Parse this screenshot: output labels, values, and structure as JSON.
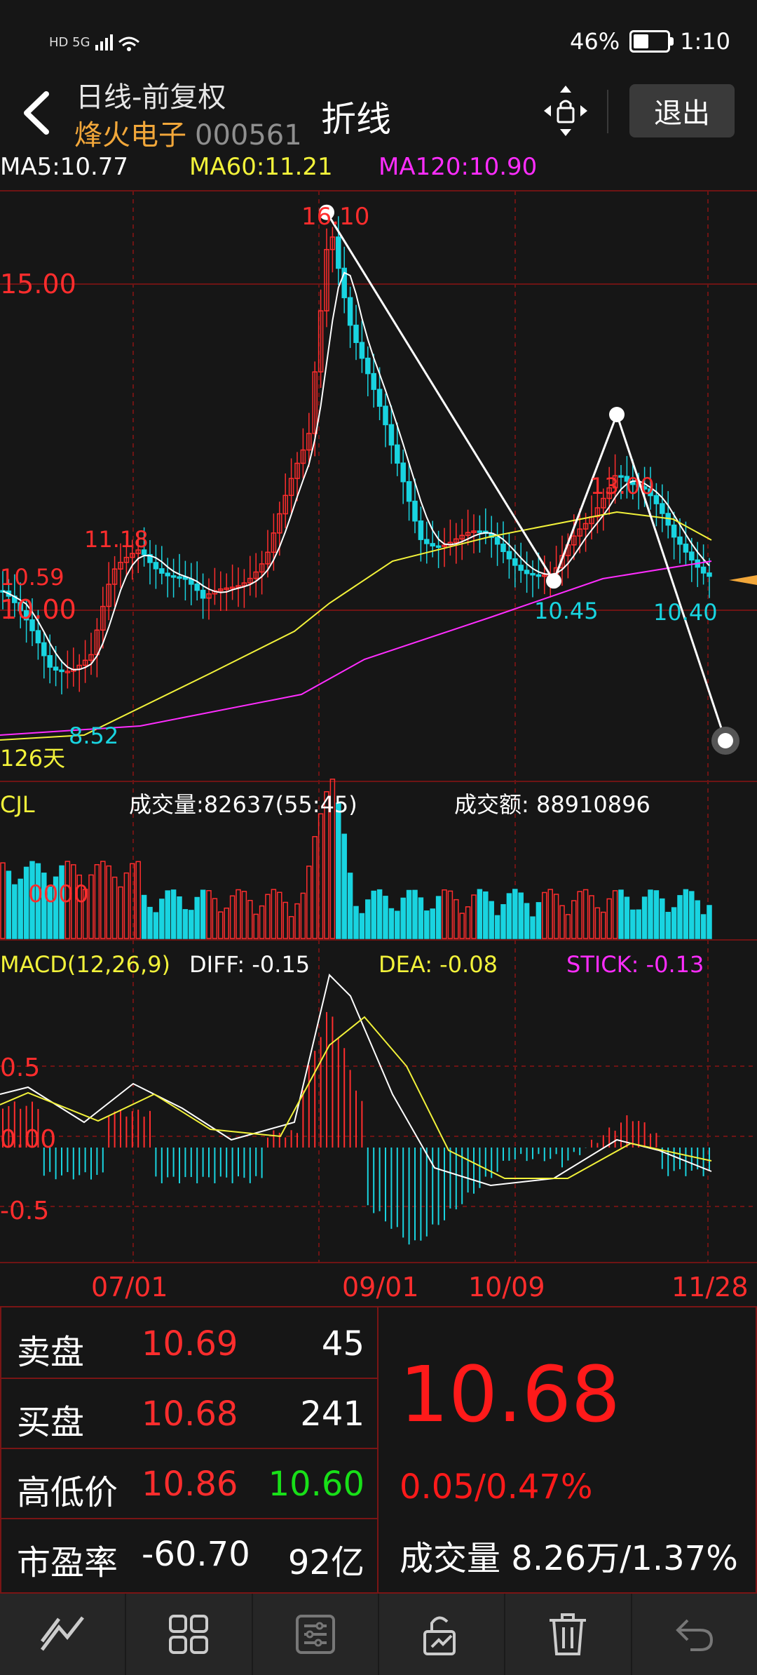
{
  "status": {
    "net": "HD 5G",
    "battery_pct": "46%",
    "battery_level": 0.46,
    "time": "1:10"
  },
  "header": {
    "line1": "日线-前复权",
    "stock_name": "烽火电子",
    "stock_code": "000561",
    "mode": "折线",
    "exit_label": "退出"
  },
  "ma_labels": {
    "ma5": "MA5:10.77",
    "ma60": "MA60:11.21",
    "ma120": "MA120:10.90"
  },
  "price_labels": {
    "high": "16.10",
    "y15": "15.00",
    "y10": "10.00",
    "p1118": "11.18",
    "p1059": "10.59",
    "low852": "8.52",
    "p1045": "10.45",
    "p1300": "13.00",
    "p1040": "10.40",
    "days": "126天"
  },
  "volume": {
    "label": "CJL",
    "volume_text": "成交量:82637(55:45)",
    "amount_text": "成交额: 88910896",
    "scale": "0000"
  },
  "macd": {
    "label": "MACD(12,26,9)",
    "diff": "DIFF: -0.15",
    "dea": "DEA: -0.08",
    "stick": "STICK: -0.13",
    "y_pos": "0.5",
    "y_zero": "0.00",
    "y_neg": "-0.5"
  },
  "dates": [
    "07/01",
    "09/01",
    "10/09",
    "11/28"
  ],
  "orderbook": {
    "sell": {
      "label": "卖盘",
      "price": "10.69",
      "qty": "45"
    },
    "buy": {
      "label": "买盘",
      "price": "10.68",
      "qty": "241"
    },
    "hilo": {
      "label": "高低价",
      "high": "10.86",
      "low": "10.60"
    },
    "pe": {
      "label": "市盈率",
      "value": "-60.70",
      "mcap": "92亿"
    }
  },
  "quote": {
    "price": "10.68",
    "change": "0.05/0.47%",
    "volume_label": "成交量",
    "volume_value": "8.26万/1.37%"
  },
  "colors": {
    "up": "#ff2d2d",
    "down": "#19d4e0",
    "ma60": "#f2f23a",
    "ma120": "#ff2dff",
    "grid": "#6e1414",
    "accent": "#f2a73a"
  },
  "toolbar_icons": [
    "draw-line-icon",
    "grid-icon",
    "settings-sliders-icon",
    "unlock-icon",
    "trash-icon",
    "undo-icon"
  ],
  "chart_data": {
    "type": "line",
    "drawn_polyline_prices": [
      16.1,
      10.45,
      13.0,
      10.4,
      8.0
    ],
    "x": [
      "07/01",
      "09/01",
      "10/09",
      "11/28"
    ],
    "series": [
      {
        "name": "MA5",
        "values": [
          10.77
        ]
      },
      {
        "name": "MA60",
        "values": [
          11.21
        ]
      },
      {
        "name": "MA120",
        "values": [
          10.9
        ]
      }
    ]
  }
}
